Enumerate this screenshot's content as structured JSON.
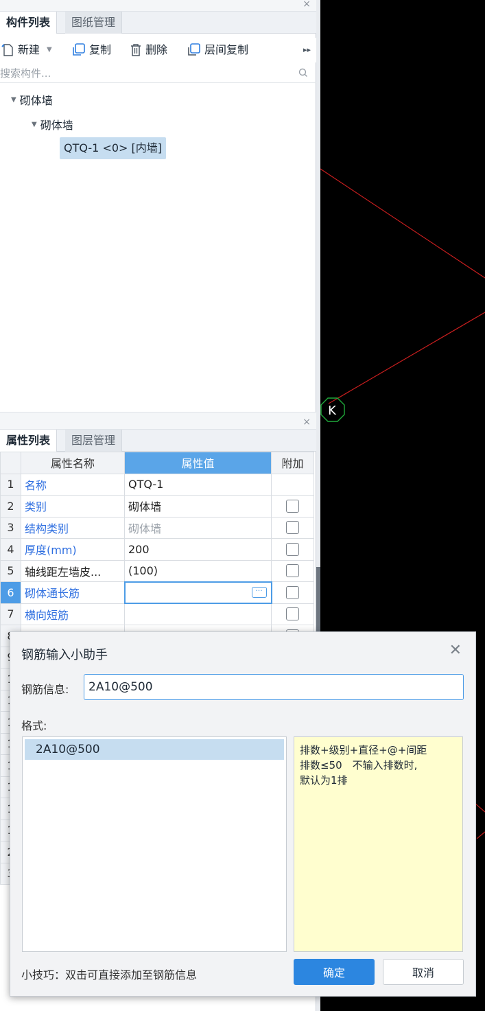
{
  "component_panel": {
    "tabs": [
      {
        "label": "构件列表",
        "active": true
      },
      {
        "label": "图纸管理",
        "active": false
      }
    ],
    "toolbar": {
      "new_label": "新建",
      "copy_label": "复制",
      "delete_label": "删除",
      "floor_copy_label": "层间复制"
    },
    "search": {
      "placeholder": "搜索构件..."
    },
    "tree": {
      "root": "砌体墙",
      "child": "砌体墙",
      "leaf": "QTQ-1 <0> [内墙]"
    }
  },
  "property_panel": {
    "tabs": [
      {
        "label": "属性列表",
        "active": true
      },
      {
        "label": "图层管理",
        "active": false
      }
    ],
    "columns": [
      "属性名称",
      "属性值",
      "附加"
    ],
    "rows": [
      {
        "num": "1",
        "name": "名称",
        "value": "QTQ-1",
        "checkbox": false
      },
      {
        "num": "2",
        "name": "类别",
        "value": "砌体墙",
        "checkbox": true
      },
      {
        "num": "3",
        "name": "结构类别",
        "value": "砌体墙",
        "checkbox": true
      },
      {
        "num": "4",
        "name": "厚度(mm)",
        "value": "200",
        "checkbox": true
      },
      {
        "num": "5",
        "name": "轴线距左墙皮...",
        "value": "(100)",
        "checkbox": true
      },
      {
        "num": "6",
        "name": "砌体通长筋",
        "value": "",
        "checkbox": true
      },
      {
        "num": "7",
        "name": "横向短筋",
        "value": "",
        "checkbox": true
      },
      {
        "num": "8",
        "name": "",
        "value": "",
        "checkbox": true
      },
      {
        "num": "9",
        "name": "",
        "value": "",
        "checkbox": false
      },
      {
        "num": "1",
        "name": "",
        "value": "",
        "checkbox": false
      },
      {
        "num": "1",
        "name": "",
        "value": "",
        "checkbox": false
      },
      {
        "num": "1",
        "name": "",
        "value": "",
        "checkbox": false
      },
      {
        "num": "1",
        "name": "",
        "value": "",
        "checkbox": false
      },
      {
        "num": "1",
        "name": "",
        "value": "",
        "checkbox": false
      },
      {
        "num": "1",
        "name": "",
        "value": "",
        "checkbox": false
      },
      {
        "num": "1",
        "name": "",
        "value": "",
        "checkbox": false
      },
      {
        "num": "1",
        "name": "",
        "value": "",
        "checkbox": false
      },
      {
        "num": "2",
        "name": "",
        "value": "",
        "checkbox": false
      },
      {
        "num": "3",
        "name": "",
        "value": "",
        "checkbox": false
      }
    ],
    "selected_row": 6
  },
  "canvas": {
    "axis_label": "K",
    "line_color": "#c81e1e",
    "marker_color": "#1fa83a"
  },
  "dialog": {
    "title": "钢筋输入小助手",
    "input_label": "钢筋信息:",
    "input_value": "2A10@500",
    "format_label": "格式:",
    "format_items": [
      "2A10@500"
    ],
    "hint_lines": [
      "排数+级别+直径+@+间距",
      "排数≤50　不输入排数时,",
      "默认为1排"
    ],
    "tip": "小技巧：双击可直接添加至钢筋信息",
    "ok_label": "确定",
    "cancel_label": "取消"
  }
}
